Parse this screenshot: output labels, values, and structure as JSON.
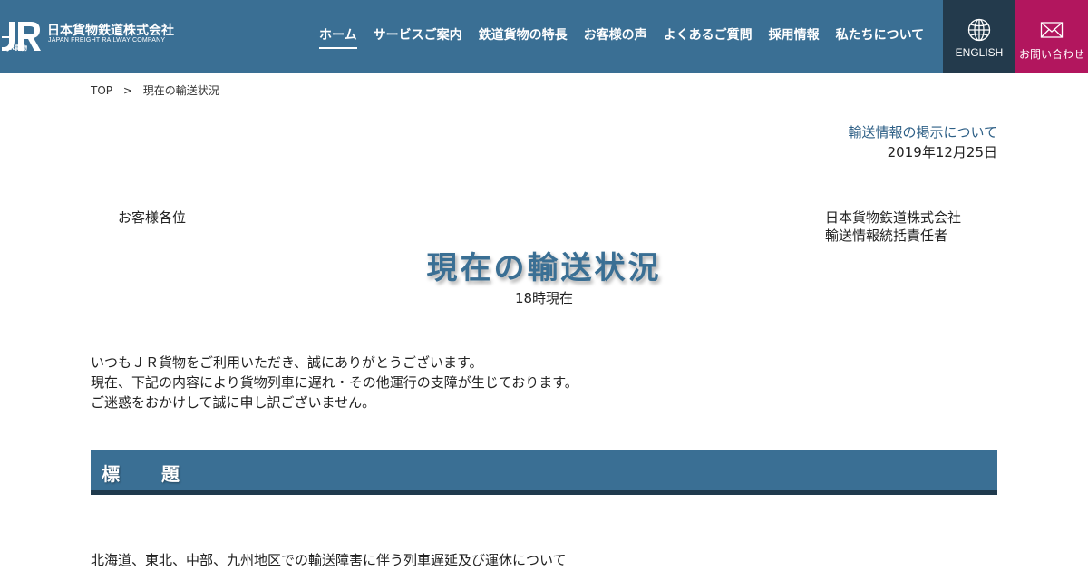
{
  "header": {
    "logo": {
      "jp_name": "日本貨物鉄道株式会社",
      "en_name": "JAPAN FREIGHT RAILWAY COMPANY",
      "sub_mark": "JR貨物"
    },
    "nav": [
      {
        "label": "ホーム",
        "active": true
      },
      {
        "label": "サービスご案内",
        "active": false
      },
      {
        "label": "鉄道貨物の特長",
        "active": false
      },
      {
        "label": "お客様の声",
        "active": false
      },
      {
        "label": "よくあるご質問",
        "active": false
      },
      {
        "label": "採用情報",
        "active": false
      },
      {
        "label": "私たちについて",
        "active": false
      }
    ],
    "english_label": "ENGLISH",
    "contact_label": "お問い合わせ"
  },
  "breadcrumb": {
    "top": "TOP",
    "separator": ">",
    "current": "現在の輸送状況"
  },
  "notice": {
    "link_text": "輸送情報の掲示について",
    "date": "2019年12月25日",
    "addressee": "お客様各位",
    "sender_line1": "日本貨物鉄道株式会社",
    "sender_line2": "輸送情報統括責任者"
  },
  "main": {
    "title": "現在の輸送状況",
    "subtitle": "18時現在",
    "paragraph": [
      "いつもＪＲ貨物をご利用いただき、誠にありがとうございます。",
      "現在、下記の内容により貨物列車に遅れ・その他運行の支障が生じております。",
      "ご迷惑をおかけして誠に申し訳ございません。"
    ],
    "section_title": "標　　題",
    "item_title": "北海道、東北、中部、九州地区での輸送障害に伴う列車遅延及び運休について"
  },
  "colors": {
    "header_bg": "#3a6f94",
    "english_bg": "#233a4c",
    "contact_bg": "#b2165e",
    "title_color": "#3a6f94",
    "link_color": "#2d5f86"
  },
  "icons": {
    "english": "globe-icon",
    "contact": "envelope-icon"
  }
}
